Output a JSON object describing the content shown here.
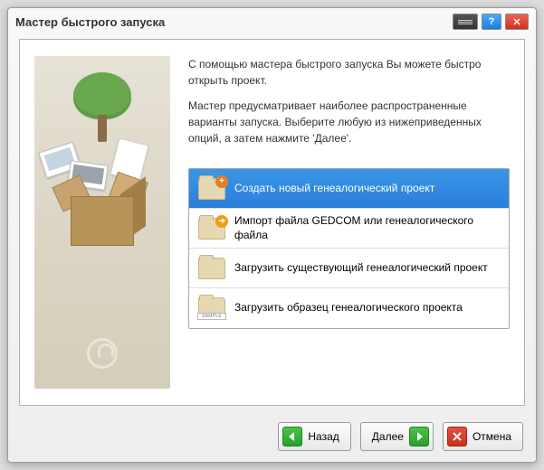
{
  "window": {
    "title": "Мастер быстрого запуска"
  },
  "intro": {
    "p1": "С помощью мастера быстрого запуска Вы можете быстро открыть проект.",
    "p2": "Мастер предусматривает наиболее распространенные варианты запуска. Выберите любую из нижеприведенных опций, а затем нажмите 'Далее'."
  },
  "options": [
    {
      "label": "Создать новый генеалогический проект"
    },
    {
      "label": "Импорт файла GEDCOM или генеалогического файла"
    },
    {
      "label": "Загрузить существующий генеалогический проект"
    },
    {
      "label": "Загрузить образец генеалогического проекта"
    }
  ],
  "buttons": {
    "back": "Назад",
    "next": "Далее",
    "cancel": "Отмена"
  }
}
